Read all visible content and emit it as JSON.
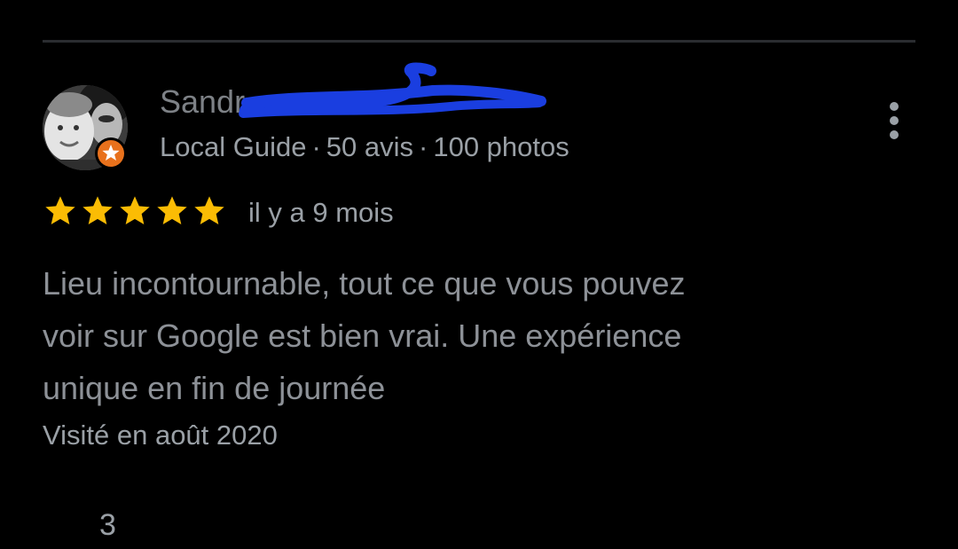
{
  "review": {
    "reviewer": {
      "name": "Sandr",
      "meta_guide": "Local Guide",
      "meta_reviews": "50 avis",
      "meta_photos": "100 photos",
      "separator": "·",
      "badge_icon": "star-badge-icon",
      "badge_color": "#e8711c"
    },
    "rating": {
      "stars": 5,
      "max": 5,
      "star_color": "#fbbc04",
      "icon": "star-icon"
    },
    "timestamp": "il y a 9 mois",
    "text": "Lieu incontournable, tout ce que vous pouvez\nvoir sur Google est bien vrai. Une expérience\nunique en fin de journée",
    "visited": "Visité en août 2020",
    "likes": "3",
    "menu_icon": "more-vert-icon",
    "redaction_color": "#1a3ee0"
  }
}
